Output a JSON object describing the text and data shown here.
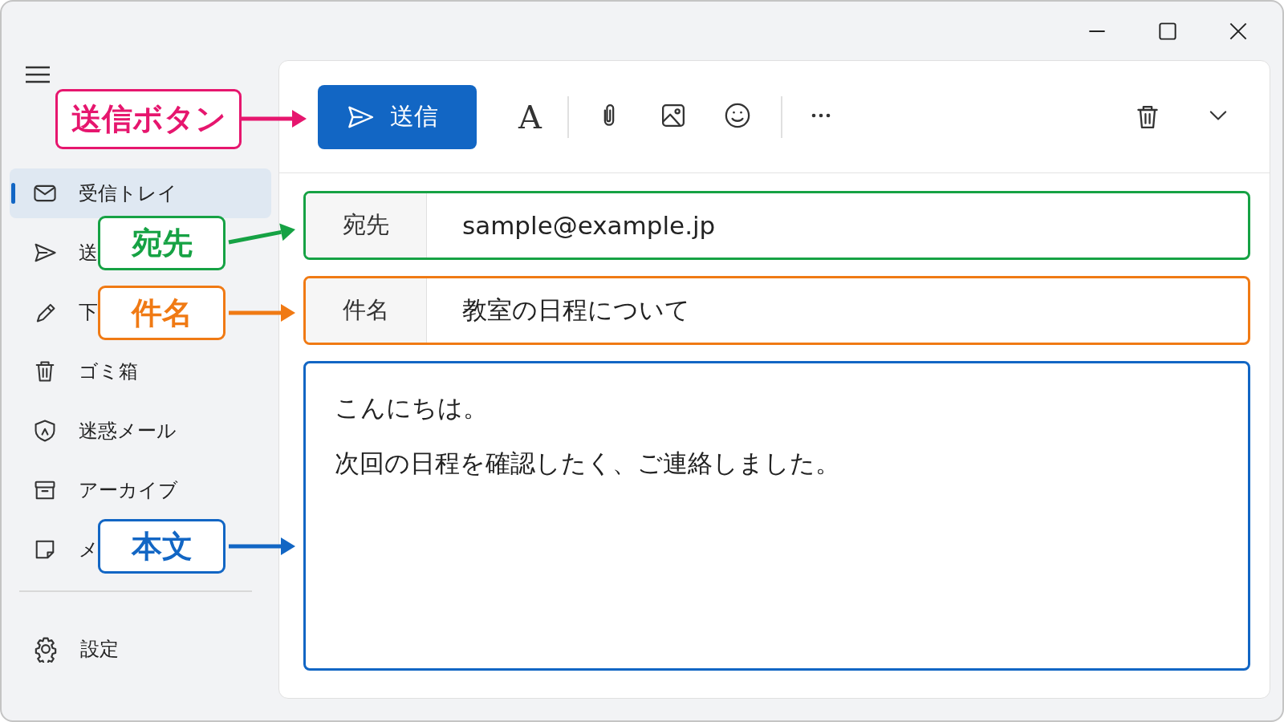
{
  "sidebar": {
    "items": [
      {
        "label": "受信トレイ",
        "selected": true
      },
      {
        "label": "送",
        "selected": false
      },
      {
        "label": "下",
        "selected": false
      },
      {
        "label": "ゴミ箱",
        "selected": false
      },
      {
        "label": "迷惑メール",
        "selected": false
      },
      {
        "label": "アーカイブ",
        "selected": false
      },
      {
        "label": "メ",
        "selected": false
      }
    ],
    "settings_label": "設定"
  },
  "toolbar": {
    "send_label": "送信",
    "format_glyph": "A"
  },
  "fields": [
    {
      "label": "宛先",
      "value": "sample@example.jp"
    },
    {
      "label": "件名",
      "value": "教室の日程について"
    }
  ],
  "body": {
    "lines": [
      "こんにちは。",
      "次回の日程を確認したく、ご連絡しました。"
    ]
  },
  "callouts": [
    {
      "label": "送信ボタン",
      "color": "#e6166e"
    },
    {
      "label": "宛先",
      "color": "#16a244"
    },
    {
      "label": "件名",
      "color": "#f07a14"
    },
    {
      "label": "本文",
      "color": "#1266c4"
    }
  ]
}
